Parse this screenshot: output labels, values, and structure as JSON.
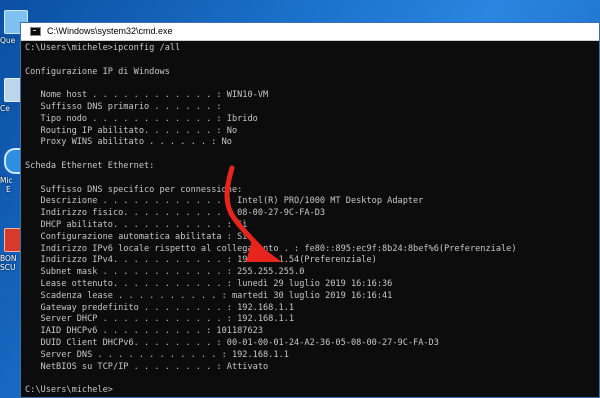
{
  "desktop": {
    "icons": [
      {
        "label": "Que"
      },
      {
        "label": "Ce"
      },
      {
        "label": "Mic"
      },
      {
        "label": "E"
      },
      {
        "label": "BON"
      },
      {
        "label": "SCU"
      }
    ]
  },
  "window": {
    "title": "C:\\Windows\\system32\\cmd.exe"
  },
  "console": {
    "lines": [
      "C:\\Users\\michele>ipconfig /all",
      "",
      "Configurazione IP di Windows",
      "",
      "   Nome host . . . . . . . . . . . . : WIN10-VM",
      "   Suffisso DNS primario . . . . . . :",
      "   Tipo nodo . . . . . . . . . . . . : Ibrido",
      "   Routing IP abilitato. . . . . . . : No",
      "   Proxy WINS abilitato . . . . . . : No",
      "",
      "Scheda Ethernet Ethernet:",
      "",
      "   Suffisso DNS specifico per connessione:",
      "   Descrizione . . . . . . . . . . . . : Intel(R) PRO/1000 MT Desktop Adapter",
      "   Indirizzo fisico. . . . . . . . . . : 08-00-27-9C-FA-D3",
      "   DHCP abilitato. . . . . . . . . . . : Sì",
      "   Configurazione automatica abilitata : Sì",
      "   Indirizzo IPv6 locale rispetto al collegamento . : fe80::895:ec9f:8b24:8bef%6(Preferenziale)",
      "   Indirizzo IPv4. . . . . . . . . . . : 192.168.1.54(Preferenziale)",
      "   Subnet mask . . . . . . . . . . . . : 255.255.255.0",
      "   Lease ottenuto. . . . . . . . . . . : lunedì 29 luglio 2019 16:16:36",
      "   Scadenza lease . . . . . . . . . . : martedì 30 luglio 2019 16:16:41",
      "   Gateway predefinito . . . . . . . . : 192.168.1.1",
      "   Server DHCP . . . . . . . . . . . . : 192.168.1.1",
      "   IAID DHCPv6 . . . . . . . . . . : 101187623",
      "   DUID Client DHCPv6. . . . . . . . : 00-01-00-01-24-A2-36-05-08-00-27-9C-FA-D3",
      "   Server DNS . . . . . . . . . . . . : 192.168.1.1",
      "   NetBIOS su TCP/IP . . . . . . . . : Attivato",
      "",
      "C:\\Users\\michele>"
    ]
  },
  "colors": {
    "console_bg": "#0c0c0c",
    "console_text": "#c7c7c7",
    "arrow": "#e8251c"
  }
}
